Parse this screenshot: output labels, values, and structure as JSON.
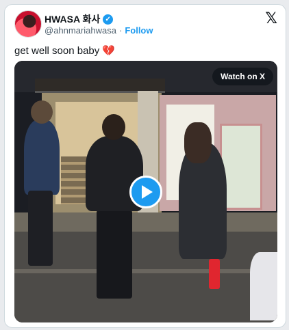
{
  "tweet": {
    "display_name": "HWASA 화사",
    "handle": "@ahnmariahwasa",
    "follow_separator": "·",
    "follow_label": "Follow",
    "text": "get well soon baby",
    "text_emoji": "💔"
  },
  "media": {
    "watch_label": "Watch on X"
  },
  "colors": {
    "accent": "#1d9bf0",
    "background": "#ffffff",
    "secondary_text": "#536471"
  },
  "icons": {
    "verified": "verified-badge-icon",
    "x_logo": "x-logo-icon",
    "play": "play-icon"
  }
}
